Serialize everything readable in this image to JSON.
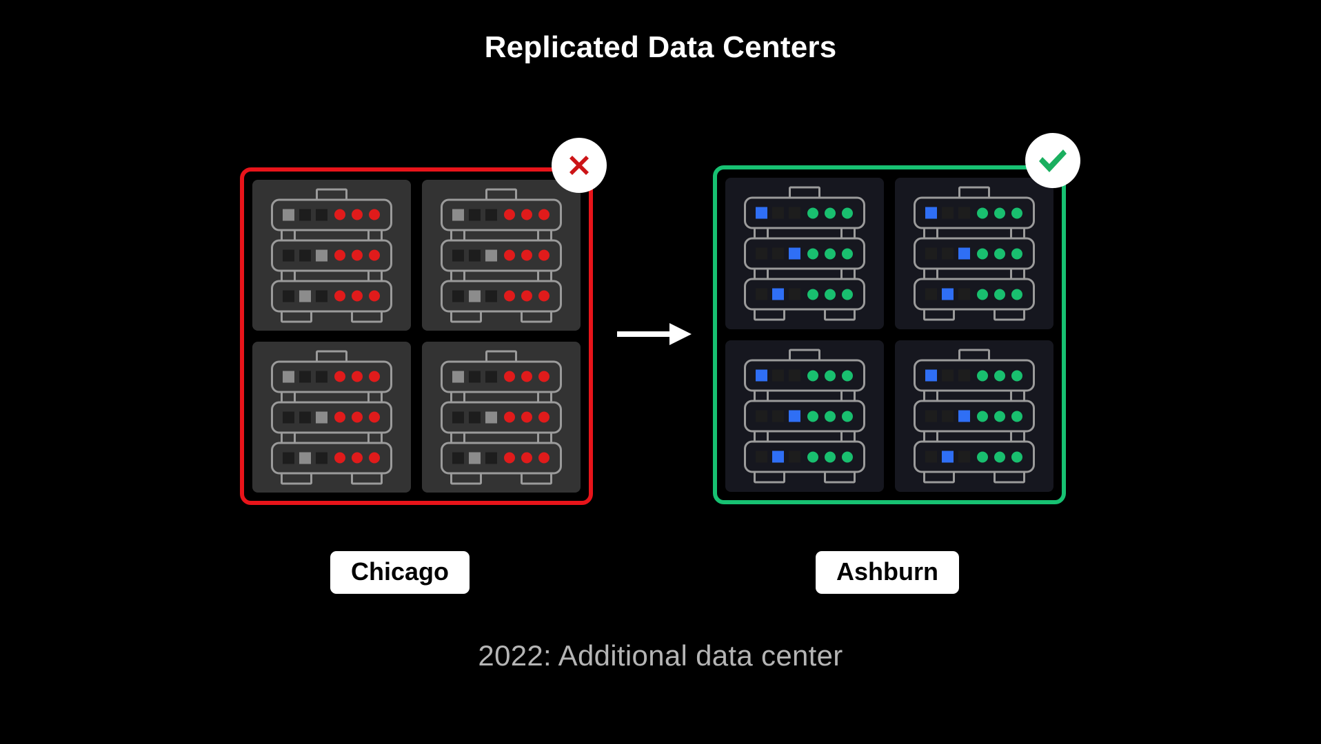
{
  "title": "Replicated Data Centers",
  "caption": "2022: Additional data center",
  "colors": {
    "background": "#000000",
    "title_text": "#ffffff",
    "caption_text": "#b5b5b5",
    "failed_border": "#e8141a",
    "healthy_border": "#17c172",
    "failed_tile": "#333333",
    "healthy_tile": "#16171f",
    "rack_outline": "#9b9b9b",
    "led_red": "#e01b1b",
    "led_green": "#19bf6f",
    "square_blue": "#2f6ff5",
    "square_gray": "#8c8c8c",
    "square_dark": "#1d1d1d",
    "badge_circle": "#ffffff",
    "badge_cross": "#cc1417",
    "badge_check": "#1aaf5f",
    "label_background": "#ffffff",
    "label_text": "#000000",
    "arrow": "#ffffff"
  },
  "datacenters": [
    {
      "id": "chicago",
      "label": "Chicago",
      "status": "failed",
      "status_icon": "cross-circle-icon",
      "border_color": "#e8141a",
      "tile_color": "#333333",
      "led_color": "#e01b1b",
      "active_square_color": "#8c8c8c",
      "racks": 4,
      "units_per_rack": 3,
      "squares_per_unit": 3,
      "leds_per_unit": 3,
      "unit_active_square_index": [
        0,
        2,
        1
      ]
    },
    {
      "id": "ashburn",
      "label": "Ashburn",
      "status": "healthy",
      "status_icon": "check-circle-icon",
      "border_color": "#17c172",
      "tile_color": "#16171f",
      "led_color": "#19bf6f",
      "active_square_color": "#2f6ff5",
      "racks": 4,
      "units_per_rack": 3,
      "squares_per_unit": 3,
      "leds_per_unit": 3,
      "unit_active_square_index": [
        0,
        2,
        1
      ]
    }
  ],
  "arrow": {
    "direction": "right",
    "icon": "arrow-right-icon"
  }
}
